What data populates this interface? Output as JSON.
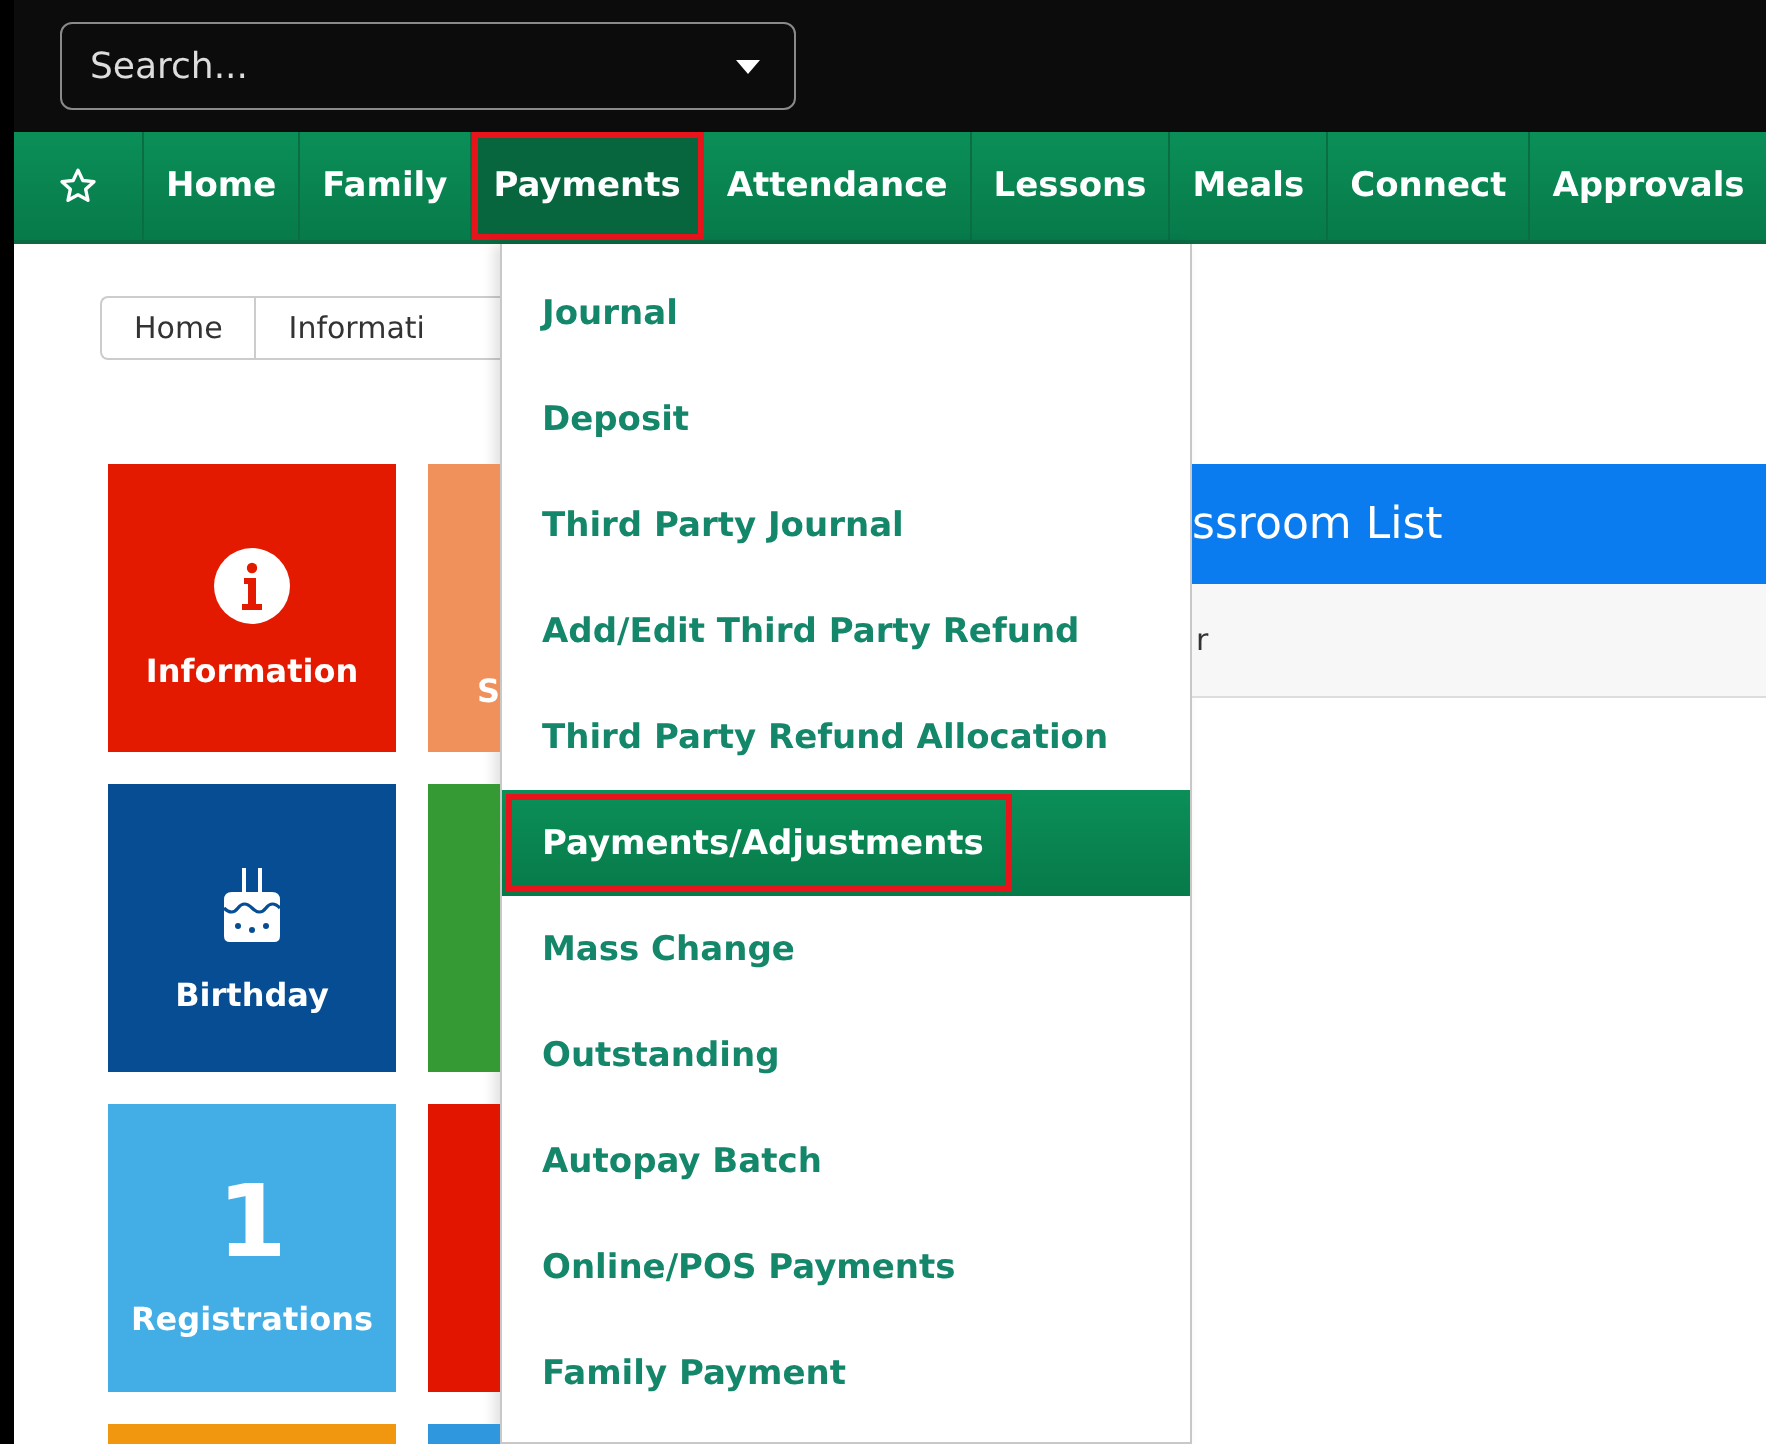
{
  "search": {
    "placeholder": "Search..."
  },
  "nav": {
    "items": [
      {
        "label": "Home",
        "selected": false,
        "highlighted": false
      },
      {
        "label": "Family",
        "selected": false,
        "highlighted": false
      },
      {
        "label": "Payments",
        "selected": true,
        "highlighted": true
      },
      {
        "label": "Attendance",
        "selected": false,
        "highlighted": false
      },
      {
        "label": "Lessons",
        "selected": false,
        "highlighted": false
      },
      {
        "label": "Meals",
        "selected": false,
        "highlighted": false
      },
      {
        "label": "Connect",
        "selected": false,
        "highlighted": false
      },
      {
        "label": "Approvals",
        "selected": false,
        "highlighted": false
      }
    ]
  },
  "breadcrumb": [
    "Home",
    "Informati"
  ],
  "tiles": [
    {
      "kind": "info",
      "label": "Information",
      "color": "#e31a00"
    },
    {
      "kind": "plain",
      "label": "S",
      "color": "#f0905a"
    },
    {
      "kind": "cake",
      "label": "Birthday",
      "color": "#064d93"
    },
    {
      "kind": "plain",
      "color": "#359a34"
    },
    {
      "kind": "count",
      "value": "1",
      "label": "Registrations",
      "color": "#43aee6"
    },
    {
      "kind": "plain",
      "color": "#e21500"
    },
    {
      "kind": "plain",
      "color": "#f0960f"
    },
    {
      "kind": "plain",
      "color": "#2e97dd"
    }
  ],
  "menu": {
    "items": [
      {
        "label": "Journal",
        "selected": false,
        "highlighted": false
      },
      {
        "label": "Deposit",
        "selected": false,
        "highlighted": false
      },
      {
        "label": "Third Party Journal",
        "selected": false,
        "highlighted": false
      },
      {
        "label": "Add/Edit Third Party Refund",
        "selected": false,
        "highlighted": false
      },
      {
        "label": "Third Party Refund Allocation",
        "selected": false,
        "highlighted": false
      },
      {
        "label": "Payments/Adjustments",
        "selected": true,
        "highlighted": true
      },
      {
        "label": "Mass Change",
        "selected": false,
        "highlighted": false
      },
      {
        "label": "Outstanding",
        "selected": false,
        "highlighted": false
      },
      {
        "label": "Autopay Batch",
        "selected": false,
        "highlighted": false
      },
      {
        "label": "Online/POS Payments",
        "selected": false,
        "highlighted": false
      },
      {
        "label": "Family Payment",
        "selected": false,
        "highlighted": false
      }
    ]
  },
  "panel": {
    "title": "ssroom List",
    "row_text": "r"
  }
}
